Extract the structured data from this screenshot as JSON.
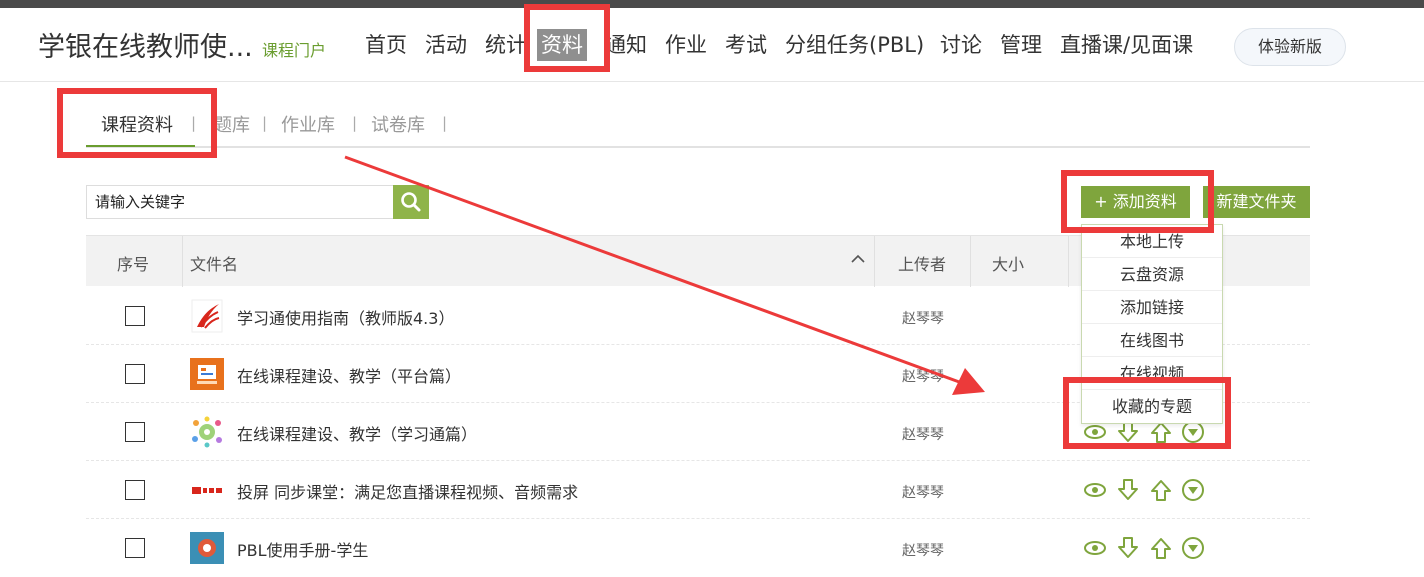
{
  "header": {
    "site_title": "学银在线教师使...",
    "portal_link": "课程门户",
    "nav": [
      "首页",
      "活动",
      "统计",
      "资料",
      "通知",
      "作业",
      "考试",
      "分组任务(PBL)",
      "讨论",
      "管理",
      "直播课/见面课"
    ],
    "active_nav": "资料",
    "try_new_label": "体验新版"
  },
  "subtabs": {
    "items": [
      "课程资料",
      "题库",
      "作业库",
      "试卷库"
    ],
    "active": "课程资料",
    "separator": "|"
  },
  "search": {
    "placeholder": "请输入关键字",
    "icon": "search-icon"
  },
  "toolbar": {
    "add_label": "+ 添加资料",
    "new_folder_label": "新建文件夹"
  },
  "add_menu": {
    "items": [
      "本地上传",
      "云盘资源",
      "添加链接",
      "在线图书",
      "在线视频",
      "收藏的专题"
    ]
  },
  "table": {
    "headers": {
      "index": "序号",
      "filename": "文件名",
      "uploader": "上传者",
      "size": "大小"
    },
    "rows": [
      {
        "name": "学习通使用指南（教师版4.3）",
        "uploader": "赵琴琴",
        "icon": "xuexitong-logo-icon"
      },
      {
        "name": "在线课程建设、教学（平台篇）",
        "uploader": "赵琴琴",
        "icon": "ppt-file-icon"
      },
      {
        "name": "在线课程建设、教学（学习通篇）",
        "uploader": "赵琴琴",
        "icon": "image-file-icon"
      },
      {
        "name": "投屏 同步课堂：满足您直播课程视频、音频需求",
        "uploader": "赵琴琴",
        "icon": "video-file-icon"
      },
      {
        "name": "PBL使用手册-学生",
        "uploader": "赵琴琴",
        "icon": "pdf-file-icon"
      }
    ],
    "row_actions": [
      "eye-icon",
      "download-icon",
      "upload-icon",
      "more-icon"
    ]
  },
  "colors": {
    "accent": "#7fa53d",
    "annotation": "#ec3a3a"
  }
}
